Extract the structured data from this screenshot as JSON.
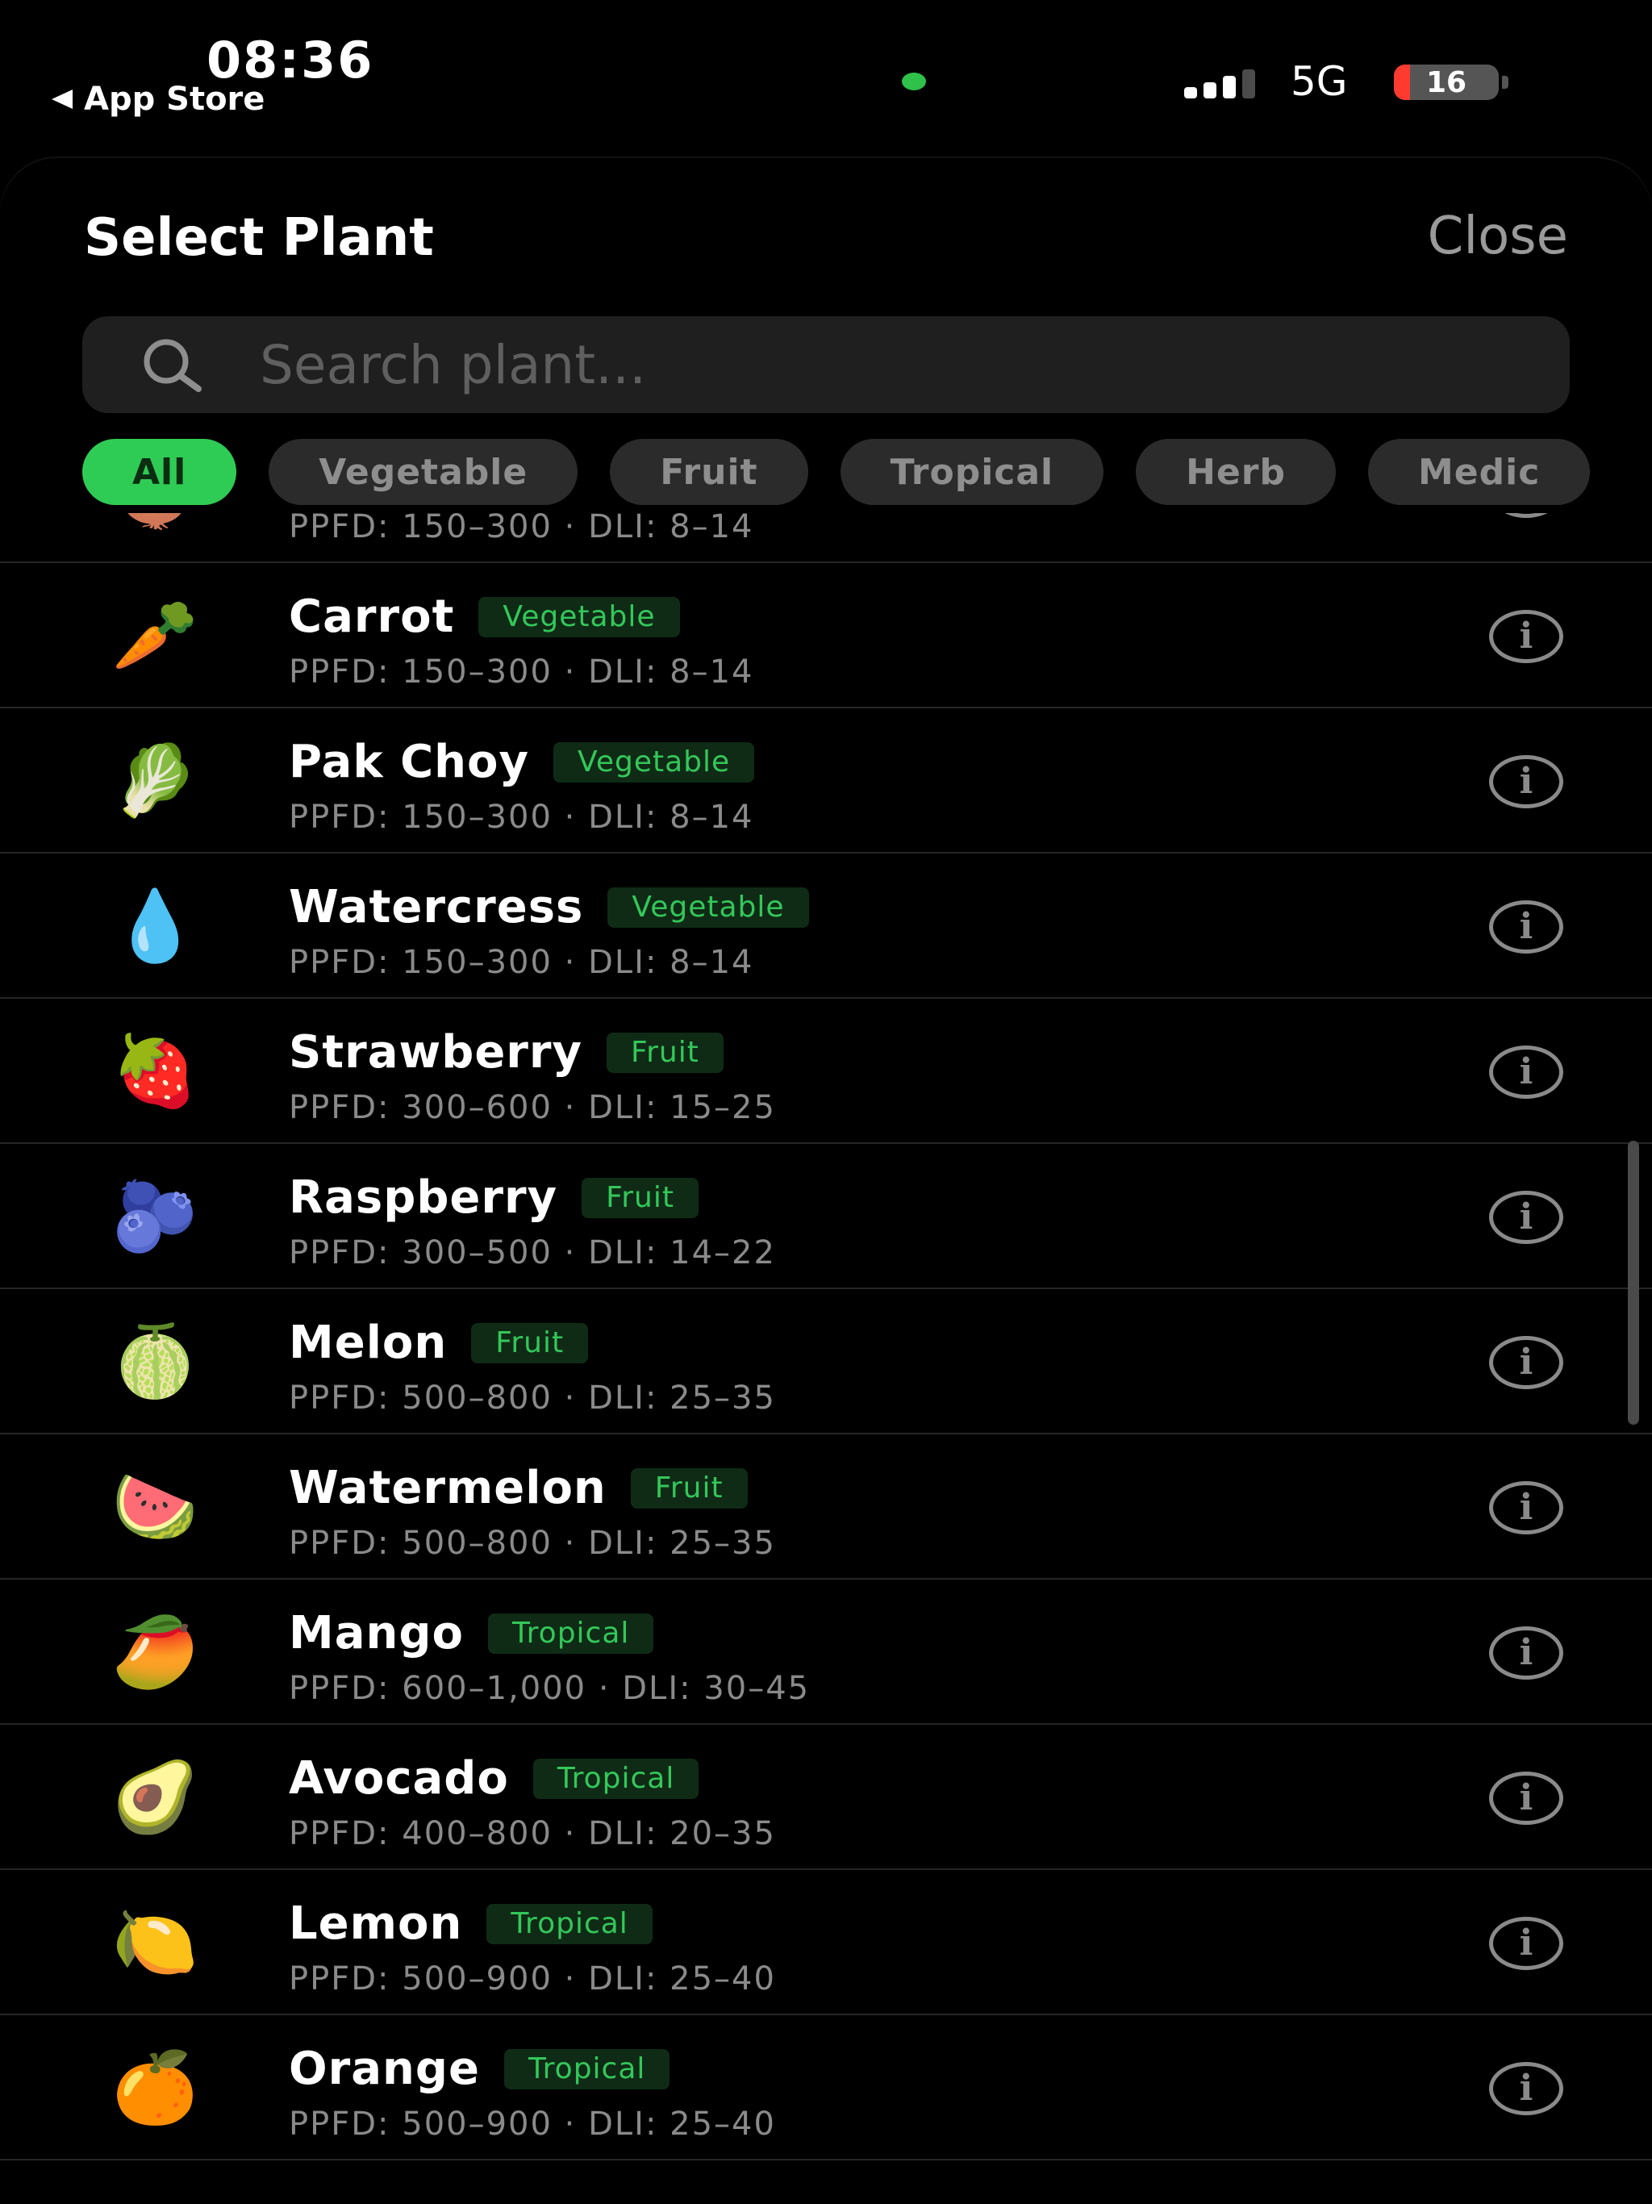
{
  "status_bar": {
    "time": "08:36",
    "back_app": "App Store",
    "network": "5G",
    "battery": "16",
    "battery_level_percent": 16,
    "colors": {
      "indicator_dot": "#30c14a",
      "battery_low": "#ff3b30"
    }
  },
  "sheet": {
    "title": "Select Plant",
    "close_label": "Close"
  },
  "search": {
    "placeholder": "Search plant...",
    "value": "",
    "icon": "search-icon"
  },
  "filters": {
    "selected": "All",
    "chips": [
      "All",
      "Vegetable",
      "Fruit",
      "Tropical",
      "Herb",
      "Medic"
    ]
  },
  "colors": {
    "accent_green": "#2fcc55",
    "tag_background": "#0f2b16",
    "tag_text": "#34c759",
    "background": "#000000",
    "muted_text": "#8a8a8a"
  },
  "plants": [
    {
      "emoji": "🧅",
      "name": "",
      "tag": "",
      "ppfd": "PPFD: 150–300 · DLI: 8–14"
    },
    {
      "emoji": "🥕",
      "name": "Carrot",
      "tag": "Vegetable",
      "ppfd": "PPFD: 150–300 · DLI: 8–14"
    },
    {
      "emoji": "🥬",
      "name": "Pak Choy",
      "tag": "Vegetable",
      "ppfd": "PPFD: 150–300 · DLI: 8–14"
    },
    {
      "emoji": "💧",
      "name": "Watercress",
      "tag": "Vegetable",
      "ppfd": "PPFD: 150–300 · DLI: 8–14"
    },
    {
      "emoji": "🍓",
      "name": "Strawberry",
      "tag": "Fruit",
      "ppfd": "PPFD: 300–600 · DLI: 15–25"
    },
    {
      "emoji": "🫐",
      "name": "Raspberry",
      "tag": "Fruit",
      "ppfd": "PPFD: 300–500 · DLI: 14–22"
    },
    {
      "emoji": "🍈",
      "name": "Melon",
      "tag": "Fruit",
      "ppfd": "PPFD: 500–800 · DLI: 25–35"
    },
    {
      "emoji": "🍉",
      "name": "Watermelon",
      "tag": "Fruit",
      "ppfd": "PPFD: 500–800 · DLI: 25–35"
    },
    {
      "emoji": "🥭",
      "name": "Mango",
      "tag": "Tropical",
      "ppfd": "PPFD: 600–1,000 · DLI: 30–45"
    },
    {
      "emoji": "🥑",
      "name": "Avocado",
      "tag": "Tropical",
      "ppfd": "PPFD: 400–800 · DLI: 20–35"
    },
    {
      "emoji": "🍋",
      "name": "Lemon",
      "tag": "Tropical",
      "ppfd": "PPFD: 500–900 · DLI: 25–40"
    },
    {
      "emoji": "🍊",
      "name": "Orange",
      "tag": "Tropical",
      "ppfd": "PPFD: 500–900 · DLI: 25–40"
    }
  ]
}
